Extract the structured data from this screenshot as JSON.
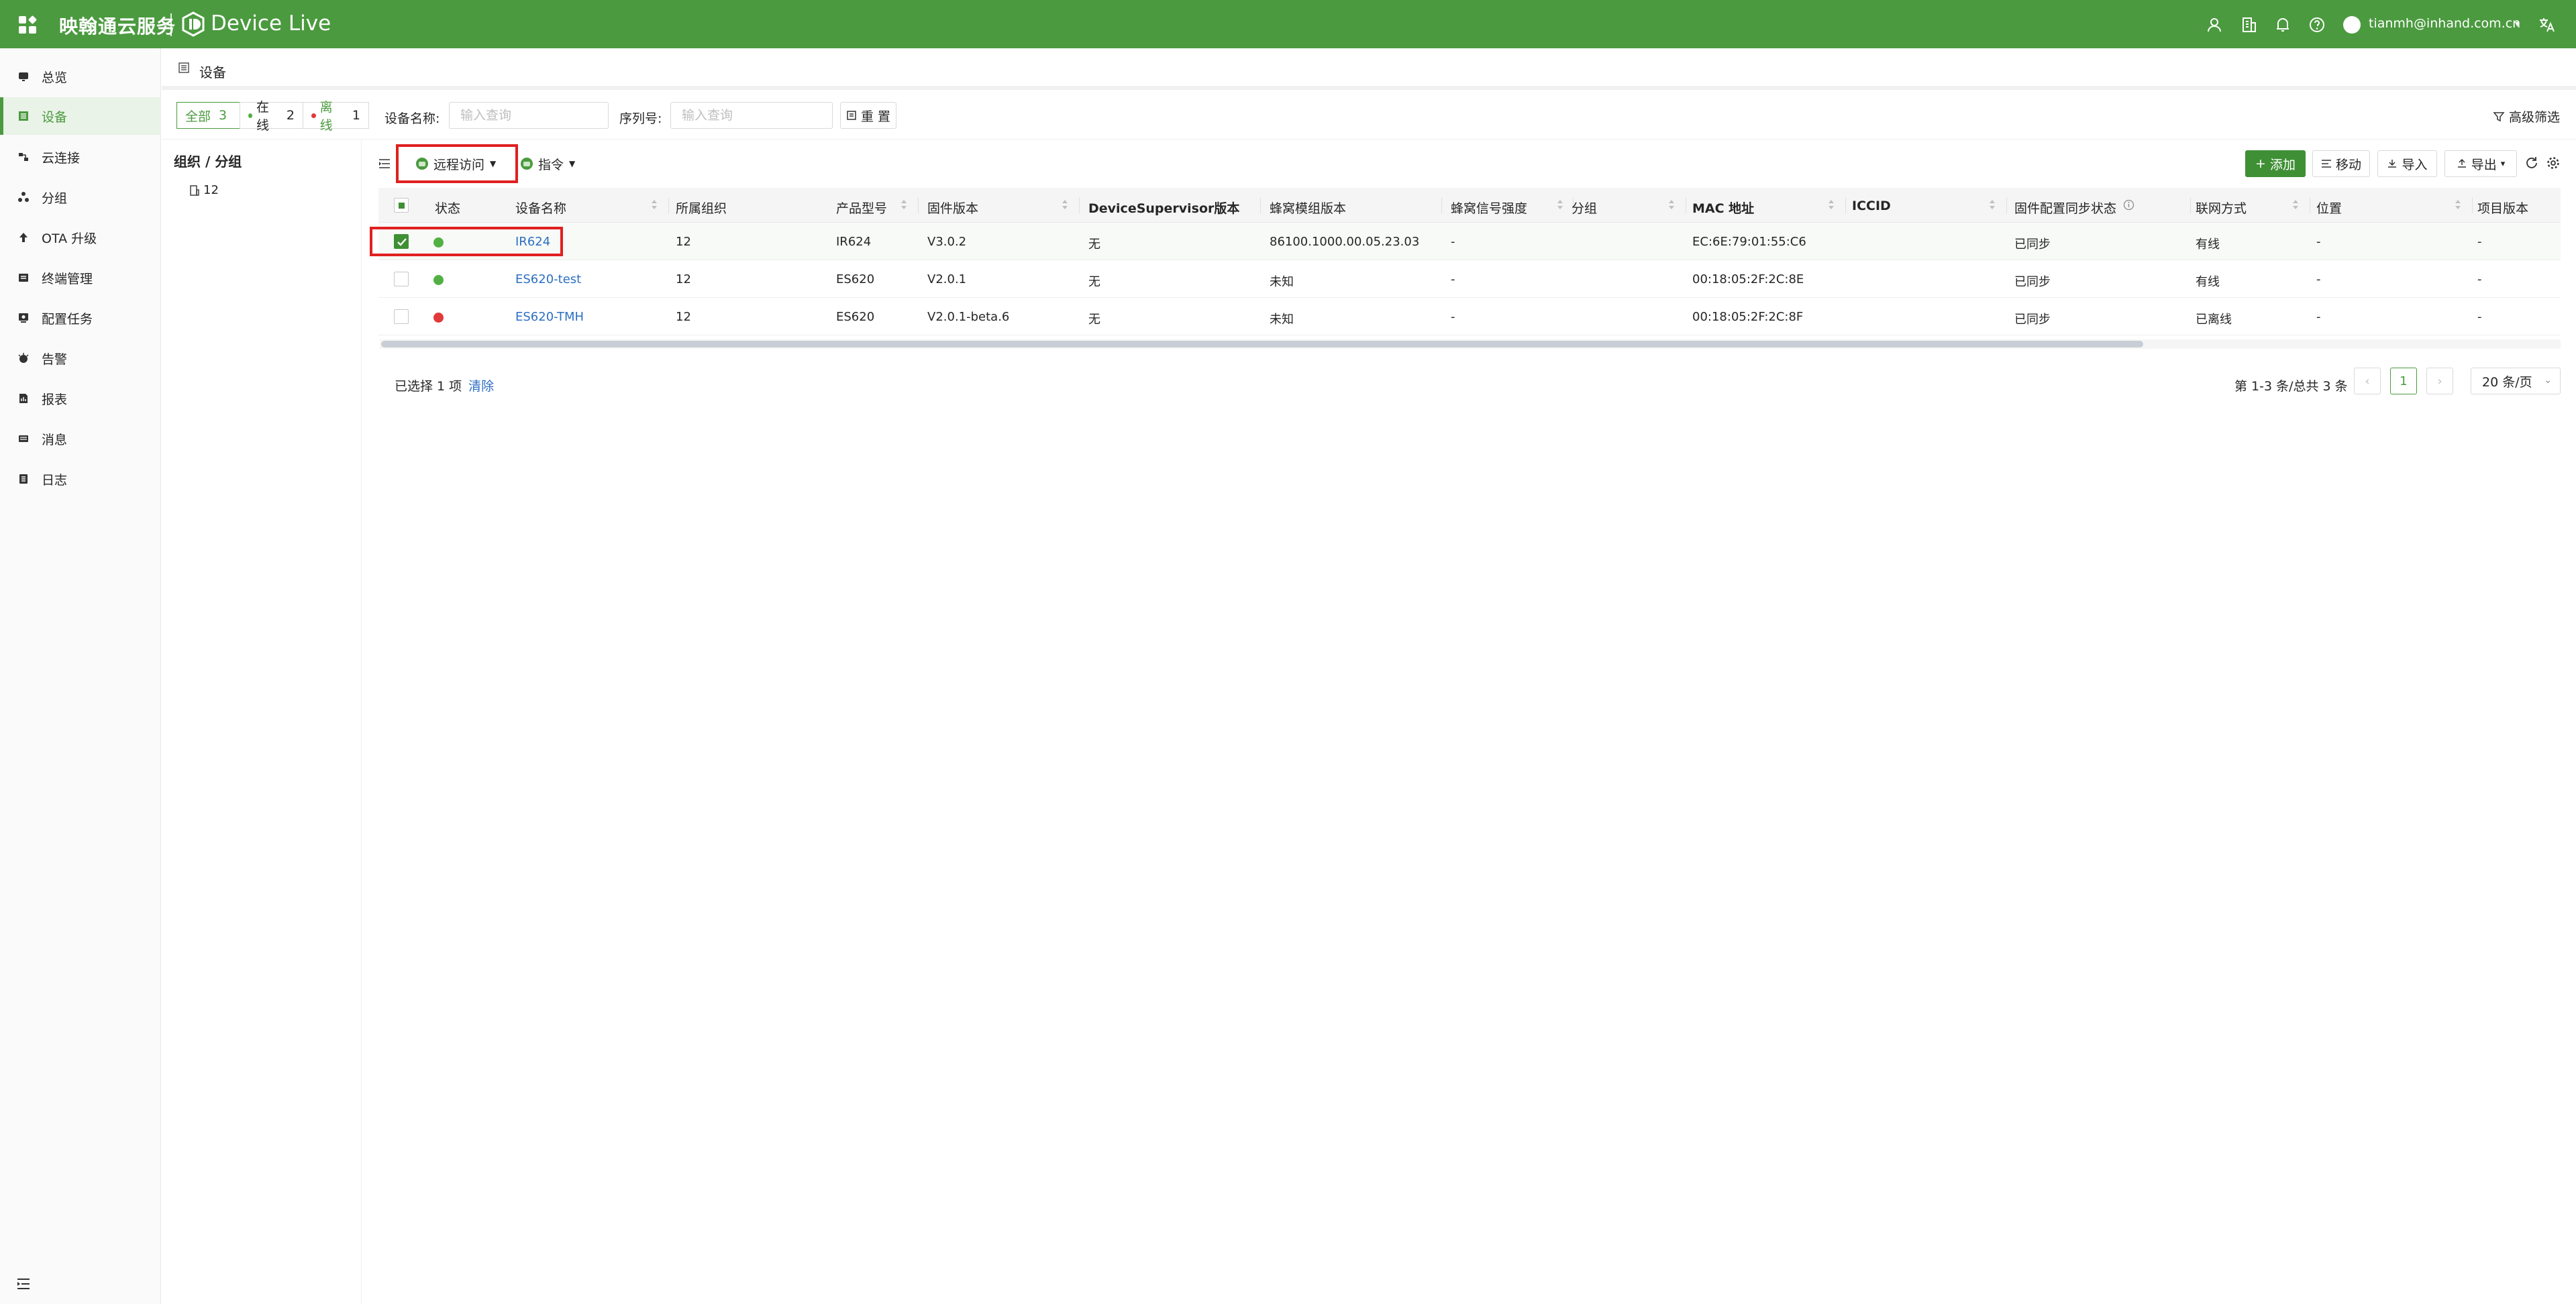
{
  "header": {
    "brand": "映翰通云服务",
    "product": "Device Live",
    "user_email": "tianmh@inhand.com.cn",
    "icons": [
      "user-icon",
      "building-icon",
      "bell-icon",
      "help-icon",
      "translate-icon"
    ]
  },
  "sidebar": {
    "items": [
      {
        "label": "总览",
        "icon": "dashboard-icon"
      },
      {
        "label": "设备",
        "icon": "device-list-icon",
        "active": true
      },
      {
        "label": "云连接",
        "icon": "cloud-connect-icon"
      },
      {
        "label": "分组",
        "icon": "group-icon"
      },
      {
        "label": "OTA 升级",
        "icon": "upload-icon"
      },
      {
        "label": "终端管理",
        "icon": "terminal-icon"
      },
      {
        "label": "配置任务",
        "icon": "config-task-icon"
      },
      {
        "label": "告警",
        "icon": "alarm-icon"
      },
      {
        "label": "报表",
        "icon": "report-icon"
      },
      {
        "label": "消息",
        "icon": "message-icon"
      },
      {
        "label": "日志",
        "icon": "log-icon"
      }
    ]
  },
  "page": {
    "title": "设备"
  },
  "filters": {
    "all_label": "全部",
    "all_count": "3",
    "online_label": "在线",
    "online_count": "2",
    "offline_label": "离线",
    "offline_count": "1",
    "name_label": "设备名称:",
    "name_placeholder": "输入查询",
    "serial_label": "序列号:",
    "serial_placeholder": "输入查询",
    "reset_label": "重 置",
    "advanced_label": "高级筛选"
  },
  "tree": {
    "title": "组织 / 分组",
    "nodes": [
      "12"
    ]
  },
  "toolbar": {
    "remote_access": "远程访问",
    "command": "指令",
    "add": "添加",
    "move": "移动",
    "import": "导入",
    "export": "导出"
  },
  "table": {
    "columns": [
      "状态",
      "设备名称",
      "所属组织",
      "产品型号",
      "固件版本",
      "DeviceSupervisor版本",
      "蜂窝模组版本",
      "蜂窝信号强度",
      "分组",
      "MAC 地址",
      "ICCID",
      "固件配置同步状态",
      "联网方式",
      "位置",
      "项目版本"
    ],
    "rows": [
      {
        "status": "online",
        "name": "IR624",
        "org": "12",
        "model": "IR624",
        "firmware": "V3.0.2",
        "ds_version": "无",
        "module": "86100.1000.00.05.23.03",
        "signal": "-",
        "group": "",
        "mac": "EC:6E:79:01:55:C6",
        "iccid": "",
        "sync": "已同步",
        "network": "有线",
        "location": "-",
        "project": "-",
        "checked": true
      },
      {
        "status": "online",
        "name": "ES620-test",
        "org": "12",
        "model": "ES620",
        "firmware": "V2.0.1",
        "ds_version": "无",
        "module": "未知",
        "signal": "-",
        "group": "",
        "mac": "00:18:05:2F:2C:8E",
        "iccid": "",
        "sync": "已同步",
        "network": "有线",
        "location": "-",
        "project": "-",
        "checked": false
      },
      {
        "status": "offline",
        "name": "ES620-TMH",
        "org": "12",
        "model": "ES620",
        "firmware": "V2.0.1-beta.6",
        "ds_version": "无",
        "module": "未知",
        "signal": "-",
        "group": "",
        "mac": "00:18:05:2F:2C:8F",
        "iccid": "",
        "sync": "已同步",
        "network": "已离线",
        "location": "-",
        "project": "-",
        "checked": false
      }
    ]
  },
  "footer": {
    "selected_text": "已选择 1 项",
    "clear_label": "清除",
    "total_text": "第 1-3 条/总共 3 条",
    "current_page": "1",
    "page_size": "20 条/页"
  },
  "colors": {
    "brand": "#4b9a3f",
    "online": "#52b043",
    "offline": "#e03a3a",
    "link": "#2d6fc4",
    "highlight": "#e02020"
  }
}
